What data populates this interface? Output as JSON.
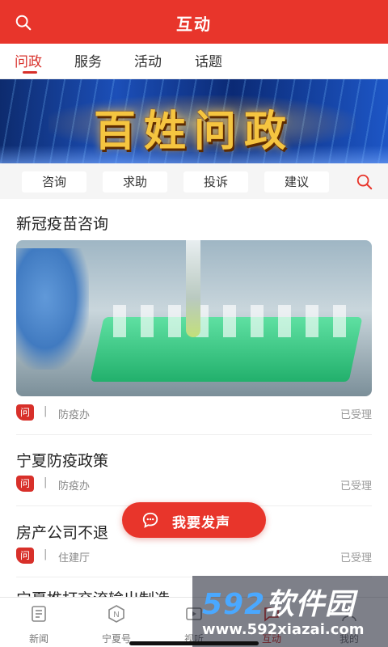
{
  "header": {
    "title": "互动",
    "search_icon": "search-icon"
  },
  "tabs": [
    {
      "label": "问政",
      "active": true
    },
    {
      "label": "服务",
      "active": false
    },
    {
      "label": "活动",
      "active": false
    },
    {
      "label": "话题",
      "active": false
    }
  ],
  "banner": {
    "text": "百姓问政"
  },
  "subcategories": {
    "items": [
      "咨询",
      "求助",
      "投诉",
      "建议"
    ],
    "search_icon": "search-icon"
  },
  "feed": [
    {
      "title": "新冠疫苗咨询",
      "badge": "问",
      "separator": "|",
      "dept": "防疫办",
      "status": "已受理",
      "has_image": true
    },
    {
      "title": "宁夏防疫政策",
      "badge": "问",
      "separator": "|",
      "dept": "防疫办",
      "status": "已受理"
    },
    {
      "title": "房产公司不退",
      "badge": "问",
      "separator": "|",
      "dept": "住建厅",
      "status": "已受理"
    },
    {
      "title": "宁夏推打交流输出制造"
    }
  ],
  "fab": {
    "label": "我要发声",
    "icon": "chat-bubble-icon"
  },
  "bottom_nav": [
    {
      "label": "新闻",
      "icon": "news-icon",
      "active": false
    },
    {
      "label": "宁夏号",
      "icon": "ningxia-hao-icon",
      "active": false
    },
    {
      "label": "视听",
      "icon": "video-icon",
      "active": false
    },
    {
      "label": "互动",
      "icon": "interact-icon",
      "active": true
    },
    {
      "label": "我的",
      "icon": "profile-icon",
      "active": false
    }
  ],
  "watermark": {
    "brand_number": "592",
    "brand_text": "软件园",
    "url": "www.592xiazai.com"
  },
  "colors": {
    "primary": "#e8352b",
    "active_text": "#d8302a",
    "chip_bg": "#f5f5f5"
  }
}
